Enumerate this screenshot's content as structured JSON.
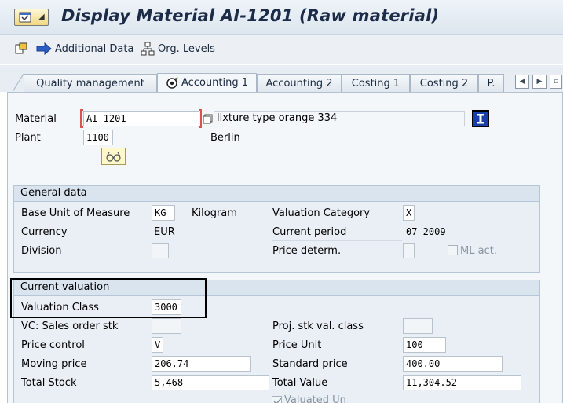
{
  "window": {
    "title": "Display Material AI-1201 (Raw material)"
  },
  "toolbar": {
    "additional_data": "Additional Data",
    "org_levels": "Org. Levels"
  },
  "tabs": [
    {
      "label": "Quality management",
      "active": false
    },
    {
      "label": "Accounting 1",
      "active": true
    },
    {
      "label": "Accounting 2",
      "active": false
    },
    {
      "label": "Costing 1",
      "active": false
    },
    {
      "label": "Costing 2",
      "active": false
    },
    {
      "label": "P.",
      "active": false
    }
  ],
  "header": {
    "material_label": "Material",
    "material_value": "AI-1201",
    "material_description": "lixture type orange 334",
    "plant_label": "Plant",
    "plant_value": "1100",
    "plant_name": "Berlin"
  },
  "general_data": {
    "title": "General data",
    "base_uom_label": "Base Unit of Measure",
    "base_uom_value": "KG",
    "base_uom_text": "Kilogram",
    "valuation_category_label": "Valuation Category",
    "valuation_category_value": "X",
    "currency_label": "Currency",
    "currency_value": "EUR",
    "current_period_label": "Current period",
    "current_period_value": "07 2009",
    "division_label": "Division",
    "division_value": "",
    "price_determ_label": "Price determ.",
    "price_determ_value": "",
    "ml_act_label": "ML act.",
    "ml_act_checked": false
  },
  "current_valuation": {
    "title": "Current valuation",
    "valuation_class_label": "Valuation Class",
    "valuation_class_value": "3000",
    "vc_sales_order_stk_label": "VC: Sales order stk",
    "vc_sales_order_stk_value": "",
    "proj_stk_val_class_label": "Proj. stk val. class",
    "proj_stk_val_class_value": "",
    "price_control_label": "Price control",
    "price_control_value": "V",
    "price_unit_label": "Price Unit",
    "price_unit_value": "100",
    "moving_price_label": "Moving price",
    "moving_price_value": "206.74",
    "standard_price_label": "Standard price",
    "standard_price_value": "400.00",
    "total_stock_label": "Total Stock",
    "total_stock_value": "5,468",
    "total_value_label": "Total Value",
    "total_value_value": "11,304.52",
    "valuated_un_label": "Valuated Un",
    "valuated_un_checked": true
  },
  "colors": {
    "title_text": "#1c2c48",
    "highlight_border": "#000000",
    "required_marker": "#d9534f",
    "info_button": "#1a3fa8"
  }
}
